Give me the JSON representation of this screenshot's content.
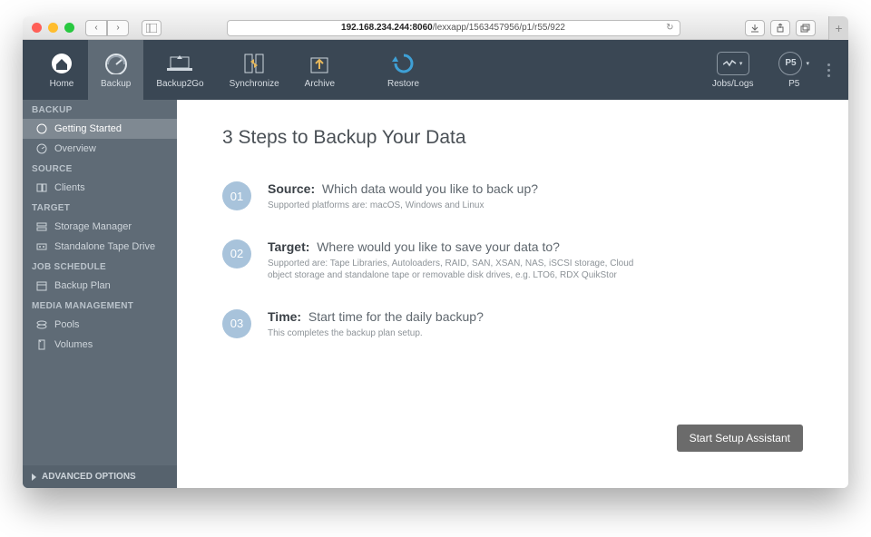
{
  "browser": {
    "address_dark": "192.168.234.244:8060",
    "address_rest": "/lexxapp/1563457956/p1/r55/922"
  },
  "header": {
    "items": [
      {
        "label": "Home"
      },
      {
        "label": "Backup"
      },
      {
        "label": "Backup2Go"
      },
      {
        "label": "Synchronize"
      },
      {
        "label": "Archive"
      },
      {
        "label": "Restore"
      }
    ],
    "right": {
      "jobs": "Jobs/Logs",
      "p5": "P5"
    }
  },
  "sidebar": {
    "sections": [
      {
        "header": "BACKUP",
        "items": [
          {
            "label": "Getting Started"
          },
          {
            "label": "Overview"
          }
        ]
      },
      {
        "header": "SOURCE",
        "items": [
          {
            "label": "Clients"
          }
        ]
      },
      {
        "header": "TARGET",
        "items": [
          {
            "label": "Storage Manager"
          },
          {
            "label": "Standalone Tape Drive"
          }
        ]
      },
      {
        "header": "JOB SCHEDULE",
        "items": [
          {
            "label": "Backup Plan"
          }
        ]
      },
      {
        "header": "MEDIA MANAGEMENT",
        "items": [
          {
            "label": "Pools"
          },
          {
            "label": "Volumes"
          }
        ]
      }
    ],
    "footer": "ADVANCED OPTIONS"
  },
  "main": {
    "title": "3 Steps to Backup Your Data",
    "steps": [
      {
        "num": "01",
        "title": "Source:",
        "text": "Which data would you like to back up?",
        "sub": "Supported platforms are: macOS, Windows and Linux"
      },
      {
        "num": "02",
        "title": "Target:",
        "text": "Where would you like to save your data to?",
        "sub": "Supported are: Tape Libraries, Autoloaders, RAID, SAN, XSAN, NAS, iSCSI storage, Cloud object storage and standalone tape or removable disk drives, e.g. LTO6, RDX QuikStor"
      },
      {
        "num": "03",
        "title": "Time:",
        "text": "Start time for the daily backup?",
        "sub": "This completes the backup plan setup."
      }
    ],
    "start": "Start Setup Assistant"
  }
}
